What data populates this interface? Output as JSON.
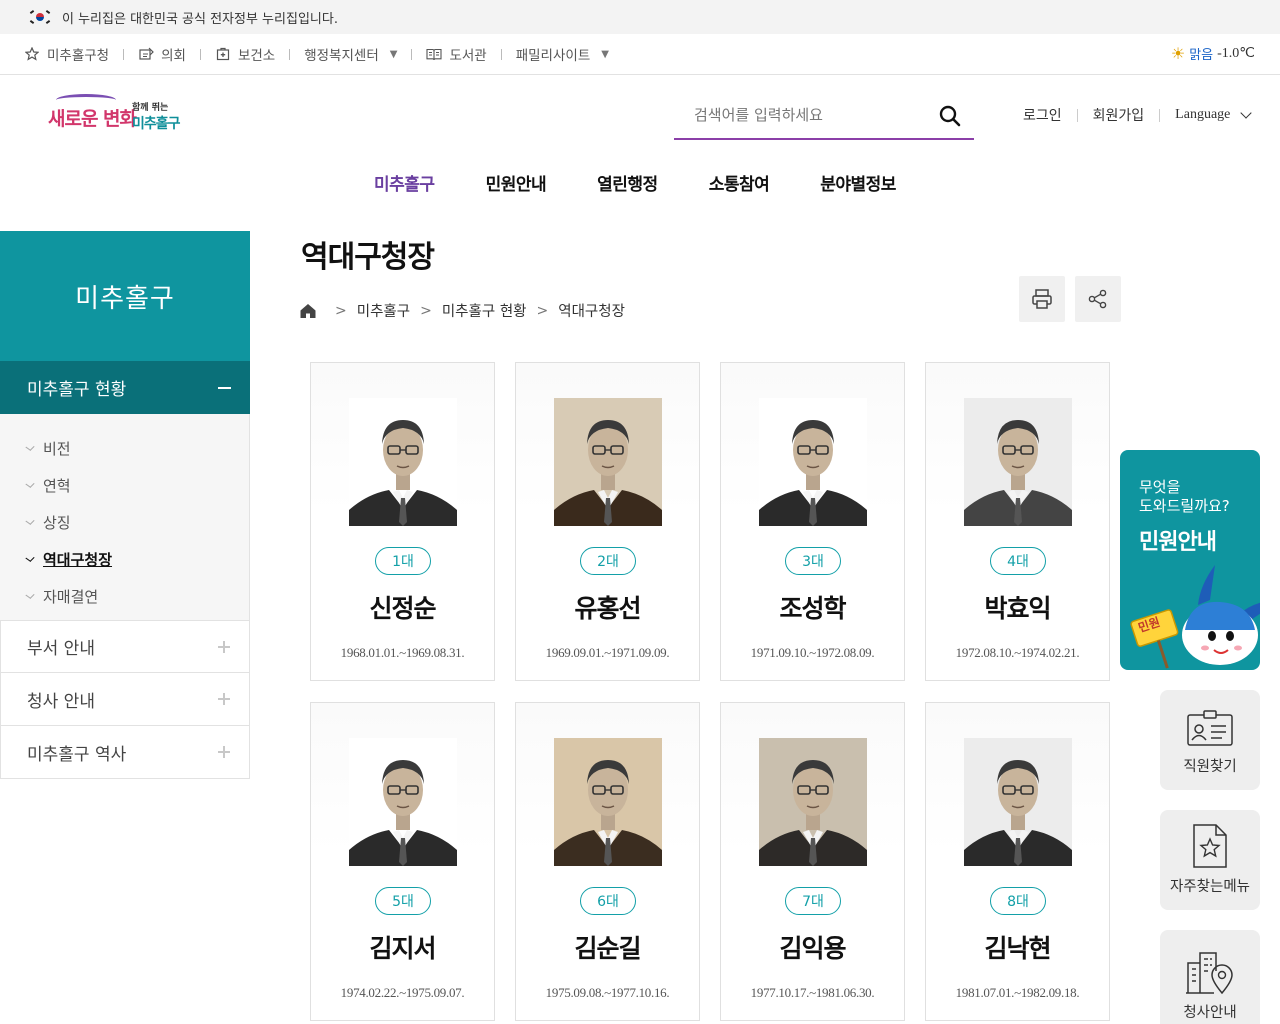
{
  "gov_banner": {
    "text": "이 누리집은 대한민국 공식 전자정부 누리집입니다."
  },
  "utility": {
    "links": [
      {
        "label": "미추홀구청",
        "icon": "star-icon"
      },
      {
        "label": "의회",
        "icon": "council-icon"
      },
      {
        "label": "보건소",
        "icon": "health-center-icon"
      },
      {
        "label": "행정복지센터",
        "icon": "dropdown-caret-icon"
      },
      {
        "label": "도서관",
        "icon": "book-icon"
      },
      {
        "label": "패밀리사이트",
        "icon": "dropdown-caret-icon"
      }
    ],
    "weather": {
      "condition": "맑음",
      "temp": "-1.0℃"
    }
  },
  "header": {
    "logo": {
      "line1": "새로운 변화",
      "line2": "함께 뛰는",
      "line3": "미추홀구"
    },
    "search": {
      "placeholder": "검색어를 입력하세요"
    },
    "login": "로그인",
    "signup": "회원가입",
    "language": "Language"
  },
  "gnb": [
    {
      "label": "미추홀구",
      "active": true
    },
    {
      "label": "민원안내",
      "active": false
    },
    {
      "label": "열린행정",
      "active": false
    },
    {
      "label": "소통참여",
      "active": false
    },
    {
      "label": "분야별정보",
      "active": false
    }
  ],
  "sidebar": {
    "title": "미추홀구",
    "current_section": "미추홀구 현황",
    "sub_items": [
      {
        "label": "비전"
      },
      {
        "label": "연혁"
      },
      {
        "label": "상징"
      },
      {
        "label": "역대구청장",
        "active": true
      },
      {
        "label": "자매결연"
      }
    ],
    "menus": [
      {
        "label": "부서 안내"
      },
      {
        "label": "청사 안내"
      },
      {
        "label": "미추홀구 역사"
      }
    ]
  },
  "content": {
    "title": "역대구청장",
    "breadcrumb": [
      "미추홀구",
      "미추홀구 현황",
      "역대구청장"
    ],
    "mayors": [
      {
        "term": "1대",
        "name": "신정순",
        "period": "1968.01.01.~1969.08.31."
      },
      {
        "term": "2대",
        "name": "유홍선",
        "period": "1969.09.01.~1971.09.09."
      },
      {
        "term": "3대",
        "name": "조성학",
        "period": "1971.09.10.~1972.08.09."
      },
      {
        "term": "4대",
        "name": "박효익",
        "period": "1972.08.10.~1974.02.21."
      },
      {
        "term": "5대",
        "name": "김지서",
        "period": "1974.02.22.~1975.09.07."
      },
      {
        "term": "6대",
        "name": "김순길",
        "period": "1975.09.08.~1977.10.16."
      },
      {
        "term": "7대",
        "name": "김익용",
        "period": "1977.10.17.~1981.06.30."
      },
      {
        "term": "8대",
        "name": "김낙현",
        "period": "1981.07.01.~1982.09.18."
      }
    ]
  },
  "quick_menu": {
    "minwon": {
      "question": [
        "무엇을",
        "도와드릴까요?"
      ],
      "title": "민원안내",
      "sign": "민원"
    },
    "items": [
      {
        "label": "직원찾기",
        "icon": "staff-id-icon"
      },
      {
        "label": "자주찾는메뉴",
        "icon": "favorite-doc-icon"
      },
      {
        "label": "청사안내",
        "icon": "building-location-icon"
      }
    ]
  },
  "colors": {
    "brand_teal": "#0f959f",
    "brand_teal_dark": "#0a7079",
    "accent_purple": "#6a3fa0"
  }
}
